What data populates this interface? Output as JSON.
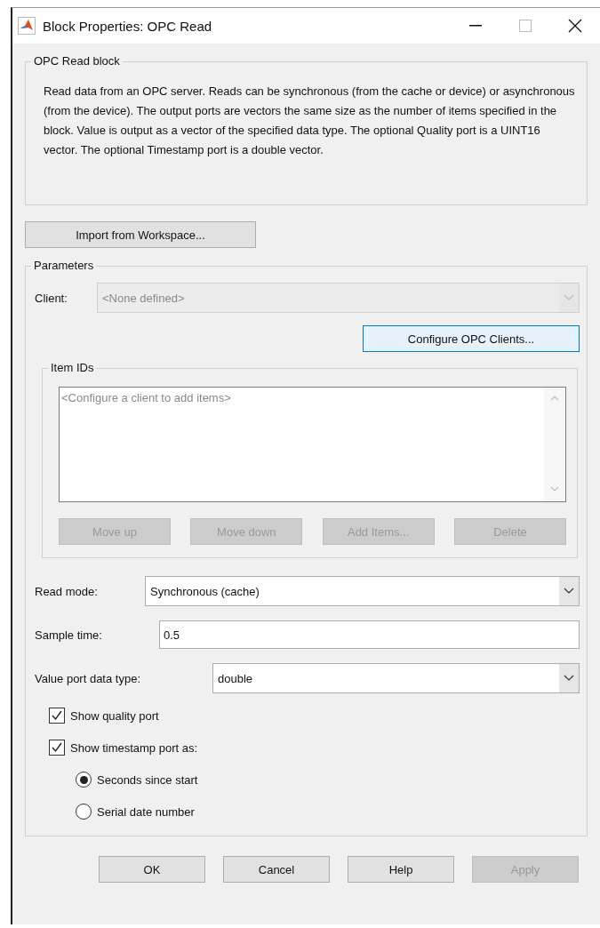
{
  "window": {
    "title": "Block Properties: OPC Read"
  },
  "description_group": {
    "title": "OPC Read block",
    "text": "Read data from an OPC server. Reads can be synchronous (from the cache or device) or asynchronous (from the device). The output ports are vectors the same size as the number of items specified in the block. Value is output as a vector of the specified data type. The optional Quality port is a UINT16 vector. The optional Timestamp port is a double vector."
  },
  "import_button": {
    "label": "Import from Workspace...",
    "disabled": false
  },
  "parameters": {
    "title": "Parameters",
    "client": {
      "label": "Client:",
      "placeholder": "<None defined>",
      "disabled": true
    },
    "configure_button": {
      "label": "Configure OPC Clients...",
      "focused": true
    },
    "item_ids": {
      "title": "Item IDs",
      "placeholder": "<Configure a client to add items>",
      "buttons": [
        {
          "label": "Move up",
          "disabled": true
        },
        {
          "label": "Move down",
          "disabled": true
        },
        {
          "label": "Add Items...",
          "disabled": true
        },
        {
          "label": "Delete",
          "disabled": true
        }
      ]
    },
    "read_mode": {
      "label": "Read mode:",
      "value": "Synchronous (cache)"
    },
    "sample_time": {
      "label": "Sample time:",
      "value": "0.5"
    },
    "value_port_type": {
      "label": "Value port data type:",
      "value": "double"
    },
    "checkboxes": [
      {
        "label": "Show quality port",
        "checked": true
      },
      {
        "label": "Show timestamp port as:",
        "checked": true
      }
    ],
    "radios": [
      {
        "label": "Seconds since start",
        "selected": true
      },
      {
        "label": "Serial date number",
        "selected": false
      }
    ]
  },
  "buttons": [
    {
      "label": "OK",
      "disabled": false
    },
    {
      "label": "Cancel",
      "disabled": false
    },
    {
      "label": "Help",
      "disabled": false
    },
    {
      "label": "Apply",
      "disabled": true
    }
  ]
}
